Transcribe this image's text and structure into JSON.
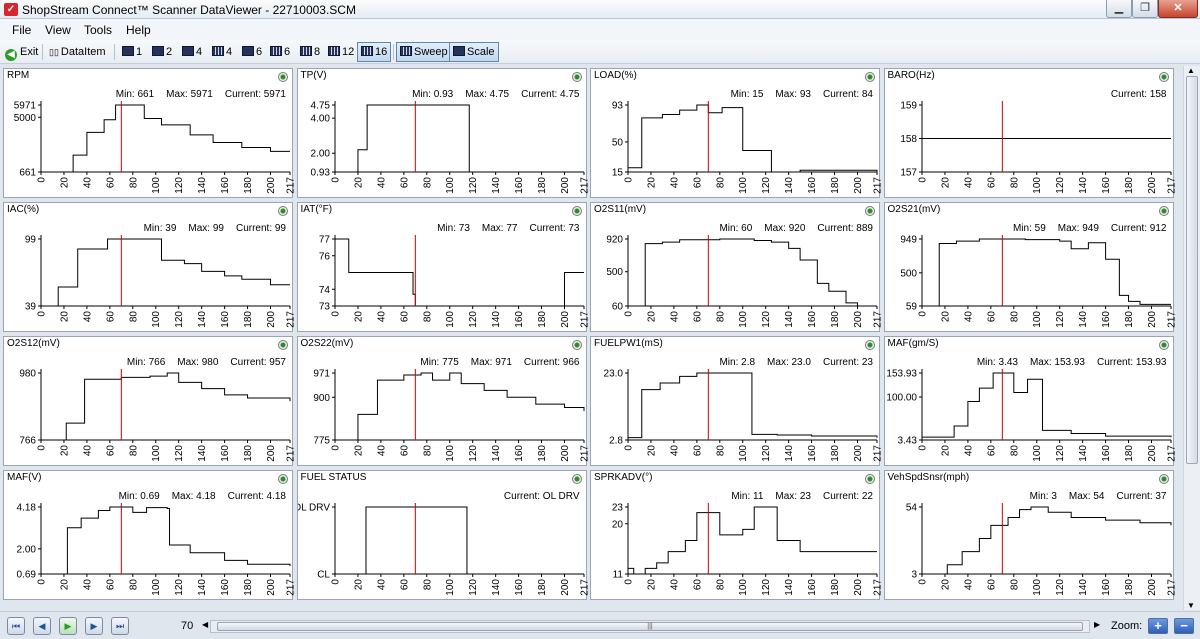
{
  "window": {
    "title": "ShopStream Connect™ Scanner DataViewer - 22710003.SCM"
  },
  "menu": [
    "File",
    "View",
    "Tools",
    "Help"
  ],
  "toolbar": {
    "exit": "Exit",
    "dataitem": "DataItem",
    "layouts": [
      "1",
      "2",
      "4",
      "4",
      "6",
      "6",
      "8",
      "12",
      "16"
    ],
    "sweep": "Sweep",
    "scale": "Scale"
  },
  "cursor_position": 70,
  "zoom_label": "Zoom:",
  "colors": {
    "cursor": "#cc0000",
    "plot_line": "#000000",
    "panel_bg": "#ffffff"
  },
  "x_ticks": [
    "0",
    "20",
    "40",
    "60",
    "80",
    "100",
    "120",
    "140",
    "160",
    "180",
    "200",
    "217"
  ],
  "x_range": [
    0,
    217
  ],
  "panels": [
    {
      "title": "RPM",
      "stats": [
        "Min: 661",
        "Max: 5971",
        "Current: 5971"
      ],
      "yticks": [
        {
          "v": 5971,
          "t": "5971"
        },
        {
          "v": 5000,
          "t": "5000"
        },
        {
          "v": 661,
          "t": "661"
        }
      ],
      "yrange": [
        661,
        5971
      ],
      "series": [
        [
          0,
          661
        ],
        [
          10,
          661
        ],
        [
          20,
          661
        ],
        [
          28,
          2000
        ],
        [
          40,
          3800
        ],
        [
          55,
          4800
        ],
        [
          65,
          5971
        ],
        [
          80,
          5971
        ],
        [
          90,
          4900
        ],
        [
          105,
          4400
        ],
        [
          130,
          3600
        ],
        [
          150,
          3000
        ],
        [
          175,
          2600
        ],
        [
          200,
          2300
        ],
        [
          217,
          2300
        ]
      ]
    },
    {
      "title": "TP(V)",
      "stats": [
        "Min: 0.93",
        "Max: 4.75",
        "Current: 4.75"
      ],
      "yticks": [
        {
          "v": 4.75,
          "t": "4.75"
        },
        {
          "v": 4.0,
          "t": "4.00"
        },
        {
          "v": 2.0,
          "t": "2.00"
        },
        {
          "v": 0.93,
          "t": "0.93"
        }
      ],
      "yrange": [
        0.93,
        4.75
      ],
      "series": [
        [
          0,
          0.93
        ],
        [
          10,
          0.93
        ],
        [
          20,
          2.2
        ],
        [
          28,
          4.75
        ],
        [
          115,
          4.75
        ],
        [
          117,
          0.93
        ],
        [
          217,
          0.93
        ]
      ]
    },
    {
      "title": "LOAD(%)",
      "stats": [
        "Min: 15",
        "Max: 93",
        "Current: 84"
      ],
      "yticks": [
        {
          "v": 93,
          "t": "93"
        },
        {
          "v": 50,
          "t": "50"
        },
        {
          "v": 15,
          "t": "15"
        }
      ],
      "yrange": [
        15,
        93
      ],
      "series": [
        [
          0,
          20
        ],
        [
          10,
          20
        ],
        [
          12,
          78
        ],
        [
          30,
          82
        ],
        [
          45,
          87
        ],
        [
          60,
          93
        ],
        [
          70,
          84
        ],
        [
          82,
          90
        ],
        [
          95,
          90
        ],
        [
          100,
          40
        ],
        [
          110,
          40
        ],
        [
          125,
          15
        ],
        [
          150,
          17
        ],
        [
          175,
          17
        ],
        [
          217,
          15
        ]
      ]
    },
    {
      "title": "BARO(Hz)",
      "stats": [
        "",
        "",
        "Current: 158"
      ],
      "yticks": [
        {
          "v": 159,
          "t": "159"
        },
        {
          "v": 158,
          "t": "158"
        },
        {
          "v": 157,
          "t": "157"
        }
      ],
      "yrange": [
        157,
        159
      ],
      "series": [
        [
          0,
          158
        ],
        [
          217,
          158
        ]
      ]
    },
    {
      "title": "IAC(%)",
      "stats": [
        "Min: 39",
        "Max: 99",
        "Current: 99"
      ],
      "yticks": [
        {
          "v": 99,
          "t": "99"
        },
        {
          "v": 39,
          "t": "39"
        }
      ],
      "yrange": [
        39,
        99
      ],
      "series": [
        [
          0,
          39
        ],
        [
          12,
          39
        ],
        [
          15,
          56
        ],
        [
          30,
          56
        ],
        [
          32,
          90
        ],
        [
          50,
          90
        ],
        [
          58,
          99
        ],
        [
          100,
          99
        ],
        [
          105,
          80
        ],
        [
          125,
          77
        ],
        [
          140,
          70
        ],
        [
          160,
          66
        ],
        [
          175,
          63
        ],
        [
          200,
          58
        ],
        [
          217,
          58
        ]
      ]
    },
    {
      "title": "IAT(°F)",
      "stats": [
        "Min: 73",
        "Max: 77",
        "Current: 73"
      ],
      "yticks": [
        {
          "v": 77,
          "t": "77"
        },
        {
          "v": 76,
          "t": "76"
        },
        {
          "v": 74,
          "t": "74"
        },
        {
          "v": 73,
          "t": "73"
        }
      ],
      "yrange": [
        73,
        77
      ],
      "series": [
        [
          0,
          77
        ],
        [
          10,
          77
        ],
        [
          12,
          75
        ],
        [
          60,
          75
        ],
        [
          68,
          73.7
        ],
        [
          70,
          73
        ],
        [
          195,
          73
        ],
        [
          200,
          75
        ],
        [
          217,
          75
        ]
      ]
    },
    {
      "title": "O2S11(mV)",
      "stats": [
        "Min: 60",
        "Max: 920",
        "Current: 889"
      ],
      "yticks": [
        {
          "v": 920,
          "t": "920"
        },
        {
          "v": 500,
          "t": "500"
        },
        {
          "v": 60,
          "t": "60"
        }
      ],
      "yrange": [
        60,
        920
      ],
      "series": [
        [
          0,
          60
        ],
        [
          12,
          60
        ],
        [
          15,
          860
        ],
        [
          30,
          880
        ],
        [
          45,
          910
        ],
        [
          80,
          920
        ],
        [
          110,
          900
        ],
        [
          125,
          880
        ],
        [
          140,
          800
        ],
        [
          150,
          650
        ],
        [
          165,
          350
        ],
        [
          175,
          250
        ],
        [
          190,
          100
        ],
        [
          200,
          60
        ],
        [
          217,
          60
        ]
      ]
    },
    {
      "title": "O2S21(mV)",
      "stats": [
        "Min: 59",
        "Max: 949",
        "Current: 912"
      ],
      "yticks": [
        {
          "v": 949,
          "t": "949"
        },
        {
          "v": 500,
          "t": "500"
        },
        {
          "v": 59,
          "t": "59"
        }
      ],
      "yrange": [
        59,
        949
      ],
      "series": [
        [
          0,
          59
        ],
        [
          12,
          59
        ],
        [
          15,
          890
        ],
        [
          30,
          920
        ],
        [
          50,
          949
        ],
        [
          90,
          940
        ],
        [
          120,
          920
        ],
        [
          130,
          820
        ],
        [
          145,
          900
        ],
        [
          160,
          680
        ],
        [
          172,
          200
        ],
        [
          180,
          120
        ],
        [
          190,
          80
        ],
        [
          217,
          80
        ]
      ]
    },
    {
      "title": "O2S12(mV)",
      "stats": [
        "Min: 766",
        "Max: 980",
        "Current: 957"
      ],
      "yticks": [
        {
          "v": 980,
          "t": "980"
        },
        {
          "v": 766,
          "t": "766"
        }
      ],
      "yrange": [
        766,
        980
      ],
      "series": [
        [
          0,
          766
        ],
        [
          20,
          766
        ],
        [
          22,
          820
        ],
        [
          35,
          820
        ],
        [
          38,
          960
        ],
        [
          60,
          960
        ],
        [
          70,
          966
        ],
        [
          95,
          970
        ],
        [
          110,
          980
        ],
        [
          120,
          950
        ],
        [
          140,
          930
        ],
        [
          160,
          910
        ],
        [
          180,
          900
        ],
        [
          217,
          890
        ]
      ]
    },
    {
      "title": "O2S22(mV)",
      "stats": [
        "Min: 775",
        "Max: 971",
        "Current: 966"
      ],
      "yticks": [
        {
          "v": 971,
          "t": "971"
        },
        {
          "v": 900,
          "t": "900"
        },
        {
          "v": 775,
          "t": "775"
        }
      ],
      "yrange": [
        775,
        971
      ],
      "series": [
        [
          0,
          775
        ],
        [
          18,
          775
        ],
        [
          20,
          850
        ],
        [
          35,
          850
        ],
        [
          37,
          950
        ],
        [
          60,
          965
        ],
        [
          75,
          971
        ],
        [
          85,
          950
        ],
        [
          100,
          971
        ],
        [
          110,
          940
        ],
        [
          130,
          920
        ],
        [
          150,
          900
        ],
        [
          175,
          880
        ],
        [
          200,
          870
        ],
        [
          217,
          860
        ]
      ]
    },
    {
      "title": "FUELPW1(mS)",
      "stats": [
        "Min: 2.8",
        "Max: 23.0",
        "Current: 23"
      ],
      "yticks": [
        {
          "v": 23.0,
          "t": "23.0"
        },
        {
          "v": 2.8,
          "t": "2.8"
        }
      ],
      "yrange": [
        2.8,
        23.0
      ],
      "series": [
        [
          0,
          3.5
        ],
        [
          10,
          3.5
        ],
        [
          12,
          18
        ],
        [
          28,
          20
        ],
        [
          45,
          22
        ],
        [
          60,
          23
        ],
        [
          85,
          23
        ],
        [
          105,
          23
        ],
        [
          108,
          4.5
        ],
        [
          130,
          4.3
        ],
        [
          160,
          4
        ],
        [
          217,
          3.5
        ]
      ]
    },
    {
      "title": "MAF(gm/S)",
      "stats": [
        "Min: 3.43",
        "Max: 153.93",
        "Current: 153.93"
      ],
      "yticks": [
        {
          "v": 153.93,
          "t": "153.93"
        },
        {
          "v": 100.0,
          "t": "100.00"
        },
        {
          "v": 3.43,
          "t": "3.43"
        }
      ],
      "yrange": [
        3.43,
        153.93
      ],
      "series": [
        [
          0,
          10
        ],
        [
          25,
          10
        ],
        [
          28,
          35
        ],
        [
          40,
          90
        ],
        [
          50,
          120
        ],
        [
          62,
          153.93
        ],
        [
          76,
          153.93
        ],
        [
          80,
          110
        ],
        [
          92,
          140
        ],
        [
          100,
          140
        ],
        [
          105,
          25
        ],
        [
          130,
          18
        ],
        [
          160,
          12
        ],
        [
          217,
          10
        ]
      ]
    },
    {
      "title": "MAF(V)",
      "stats": [
        "Min: 0.69",
        "Max: 4.18",
        "Current: 4.18"
      ],
      "yticks": [
        {
          "v": 4.18,
          "t": "4.18"
        },
        {
          "v": 2.0,
          "t": "2.00"
        },
        {
          "v": 0.69,
          "t": "0.69"
        }
      ],
      "yrange": [
        0.69,
        4.18
      ],
      "series": [
        [
          0,
          0.69
        ],
        [
          20,
          0.69
        ],
        [
          23,
          3.1
        ],
        [
          35,
          3.6
        ],
        [
          50,
          4.0
        ],
        [
          60,
          4.18
        ],
        [
          72,
          4.18
        ],
        [
          80,
          3.9
        ],
        [
          92,
          4.15
        ],
        [
          110,
          4.1
        ],
        [
          112,
          2.2
        ],
        [
          130,
          1.8
        ],
        [
          160,
          1.4
        ],
        [
          180,
          1.2
        ],
        [
          217,
          1.1
        ]
      ]
    },
    {
      "title": "FUEL STATUS",
      "stats": [
        "",
        "",
        "Current: OL DRV"
      ],
      "yticks": [
        {
          "v": 1,
          "t": "OL DRV"
        },
        {
          "v": 0,
          "t": "CL"
        }
      ],
      "yrange": [
        0,
        1
      ],
      "series": [
        [
          0,
          0
        ],
        [
          25,
          0
        ],
        [
          27,
          1
        ],
        [
          113,
          1
        ],
        [
          115,
          0
        ],
        [
          217,
          0
        ]
      ]
    },
    {
      "title": "SPRKADV(°)",
      "stats": [
        "Min: 11",
        "Max: 23",
        "Current: 22"
      ],
      "yticks": [
        {
          "v": 23,
          "t": "23"
        },
        {
          "v": 20,
          "t": "20"
        },
        {
          "v": 11,
          "t": "11"
        }
      ],
      "yrange": [
        11,
        23
      ],
      "series": [
        [
          0,
          12
        ],
        [
          5,
          11
        ],
        [
          15,
          12
        ],
        [
          25,
          13
        ],
        [
          35,
          15
        ],
        [
          50,
          17
        ],
        [
          60,
          22
        ],
        [
          75,
          22
        ],
        [
          80,
          18
        ],
        [
          100,
          19
        ],
        [
          110,
          23
        ],
        [
          125,
          23
        ],
        [
          130,
          17
        ],
        [
          150,
          15
        ],
        [
          217,
          15
        ]
      ]
    },
    {
      "title": "VehSpdSnsr(mph)",
      "stats": [
        "Min: 3",
        "Max: 54",
        "Current: 37"
      ],
      "yticks": [
        {
          "v": 54,
          "t": "54"
        },
        {
          "v": 3,
          "t": "3"
        }
      ],
      "yrange": [
        3,
        54
      ],
      "series": [
        [
          0,
          3
        ],
        [
          20,
          3
        ],
        [
          22,
          10
        ],
        [
          35,
          20
        ],
        [
          50,
          30
        ],
        [
          60,
          40
        ],
        [
          75,
          46
        ],
        [
          85,
          52
        ],
        [
          95,
          54
        ],
        [
          110,
          50
        ],
        [
          130,
          46
        ],
        [
          160,
          44
        ],
        [
          190,
          42
        ],
        [
          217,
          40
        ]
      ]
    }
  ]
}
